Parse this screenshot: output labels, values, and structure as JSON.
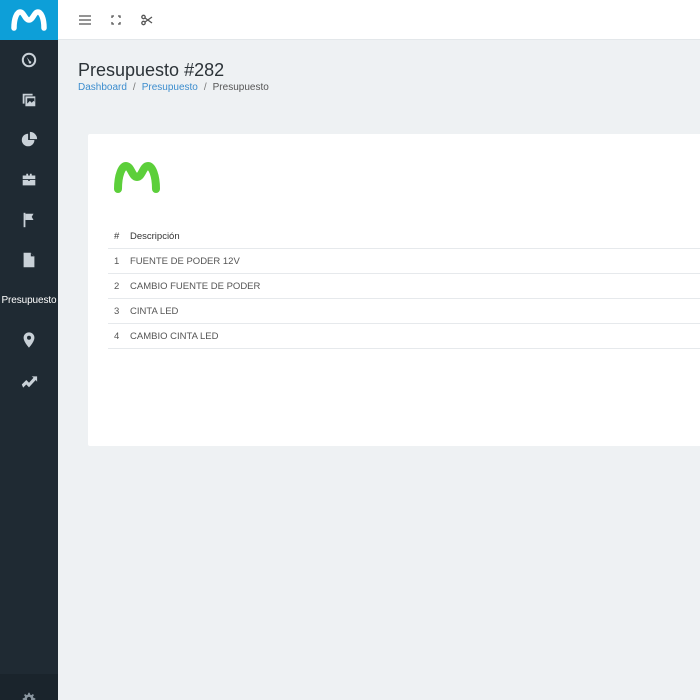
{
  "sidebar": {
    "items": [
      {
        "icon": "dashboard-gauge-icon"
      },
      {
        "icon": "images-icon"
      },
      {
        "icon": "pie-chart-icon"
      },
      {
        "icon": "briefcase-icon"
      },
      {
        "icon": "flag-icon"
      },
      {
        "icon": "document-icon"
      },
      {
        "label": "Presupuesto",
        "active": true
      },
      {
        "icon": "map-pin-icon"
      },
      {
        "icon": "trending-up-icon"
      }
    ],
    "logo_color": "#0d9fd8",
    "background": "#1f2a33"
  },
  "topbar": {
    "icons": [
      "hamburger-menu-icon",
      "fullscreen-icon",
      "scissors-icon"
    ]
  },
  "page": {
    "title": "Presupuesto #282",
    "breadcrumb": {
      "home": "Dashboard",
      "section": "Presupuesto",
      "current": "Presupuesto",
      "separator": "/"
    }
  },
  "card": {
    "logo_color": "#5ccf3a",
    "table": {
      "headers": [
        "#",
        "Descripción"
      ],
      "rows": [
        {
          "num": "1",
          "desc": "FUENTE DE PODER 12V"
        },
        {
          "num": "2",
          "desc": "CAMBIO FUENTE DE PODER"
        },
        {
          "num": "3",
          "desc": "CINTA LED"
        },
        {
          "num": "4",
          "desc": "CAMBIO CINTA LED"
        }
      ]
    }
  }
}
